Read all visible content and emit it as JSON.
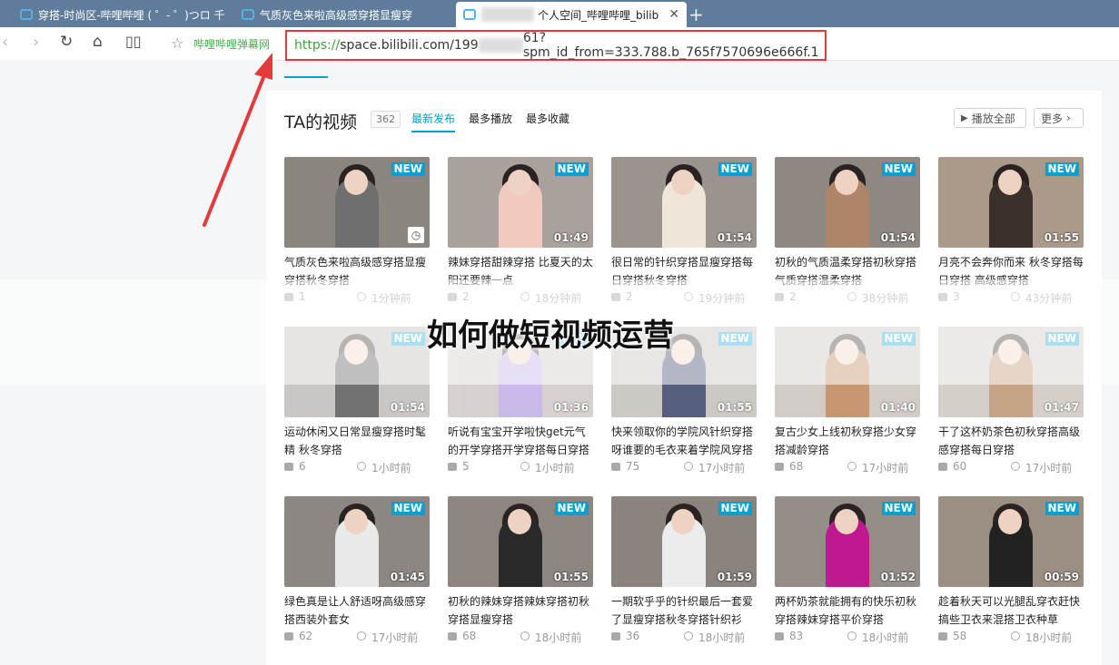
{
  "tabs": [
    {
      "label": "穿搭-时尚区-哔哩哔哩 ( ゜- ゜)つロ 千",
      "active": false
    },
    {
      "label": "气质灰色来啦高级感穿搭显瘦穿",
      "active": false
    },
    {
      "label": "个人空间_哔哩哔哩_bilib",
      "active": true
    }
  ],
  "bookmark": "哔哩哔哩弹幕网",
  "address": {
    "scheme": "https://",
    "host": "space.bilibili.com/",
    "prefix": "199",
    "suffix": "61?spm_id_from=333.788.b_765f7570696e666f.1"
  },
  "section": {
    "title": "TA的视频",
    "count": "362",
    "sorts": [
      "最新发布",
      "最多播放",
      "最多收藏"
    ],
    "play_all": "播放全部",
    "more": "更多"
  },
  "overlay_text": "如何做短视频运营",
  "videos": [
    {
      "title": "气质灰色来啦高级感穿搭显瘦穿搭秋冬穿搭",
      "new": "NEW",
      "duration": "",
      "plays": "1",
      "time": "1分钟前",
      "bg": "#8b8580",
      "cloth": "#6f6f6f"
    },
    {
      "title": "辣妹穿搭甜辣穿搭 比夏天的太阳还要辣一点",
      "new": "NEW",
      "duration": "01:49",
      "plays": "2",
      "time": "18分钟前",
      "bg": "#a9a29c",
      "cloth": "#f1c9bf"
    },
    {
      "title": "很日常的针织穿搭显瘦穿搭每日穿搭秋冬穿搭",
      "new": "NEW",
      "duration": "01:54",
      "plays": "2",
      "time": "19分钟前",
      "bg": "#9a938e",
      "cloth": "#efe6da"
    },
    {
      "title": "初秋的气质温柔穿搭初秋穿搭气质穿搭温柔穿搭",
      "new": "NEW",
      "duration": "01:54",
      "plays": "2",
      "time": "38分钟前",
      "bg": "#8f8882",
      "cloth": "#b08468"
    },
    {
      "title": "月亮不会奔你而来 秋冬穿搭每日穿搭 高级感穿搭",
      "new": "NEW",
      "duration": "01:55",
      "plays": "3",
      "time": "43分钟前",
      "bg": "#ab9a8a",
      "cloth": "#3a2f2b"
    },
    {
      "title": "运动休闲又日常显瘦穿搭时髦精 秋冬穿搭",
      "new": "NEW",
      "duration": "01:54",
      "plays": "6",
      "time": "1小时前",
      "bg": "#b9b4b0",
      "cloth": "#444444"
    },
    {
      "title": "听说有宝宝开学啦快get元气的开学穿搭开学穿搭每日穿搭",
      "new": "NEW",
      "duration": "01:36",
      "plays": "5",
      "time": "1小时前",
      "bg": "#c9c2c0",
      "cloth": "#b7a2e0"
    },
    {
      "title": "快来领取你的学院风针织穿搭呀谁要的毛衣来着学院风穿搭",
      "new": "NEW",
      "duration": "01:55",
      "plays": "75",
      "time": "17小时前",
      "bg": "#bcb6b1",
      "cloth": "#1f2a55"
    },
    {
      "title": "复古少女上线初秋穿搭少女穿搭减龄穿搭",
      "new": "NEW",
      "duration": "01:40",
      "plays": "68",
      "time": "17小时前",
      "bg": "#c2bbb4",
      "cloth": "#b8753f"
    },
    {
      "title": "干了这杯奶茶色初秋穿搭高级感穿搭每日穿搭",
      "new": "NEW",
      "duration": "01:47",
      "plays": "60",
      "time": "17小时前",
      "bg": "#c7c0b9",
      "cloth": "#b3865f"
    },
    {
      "title": "绿色真是让人舒适呀高级感穿搭西装外套女",
      "new": "NEW",
      "duration": "01:45",
      "plays": "62",
      "time": "17小时前",
      "bg": "#8c8782",
      "cloth": "#e9e9e9"
    },
    {
      "title": "初秋的辣妹穿搭辣妹穿搭初秋穿搭显瘦穿搭",
      "new": "NEW",
      "duration": "01:55",
      "plays": "68",
      "time": "18小时前",
      "bg": "#8d8580",
      "cloth": "#2a2a2a"
    },
    {
      "title": "一期软乎乎的针织最后一套爱了显瘦穿搭秋冬穿搭针织衫",
      "new": "NEW",
      "duration": "01:59",
      "plays": "36",
      "time": "18小时前",
      "bg": "#8a837e",
      "cloth": "#ececec"
    },
    {
      "title": "两杯奶茶就能拥有的快乐初秋穿搭辣妹穿搭平价穿搭",
      "new": "NEW",
      "duration": "01:52",
      "plays": "83",
      "time": "18小时前",
      "bg": "#948d88",
      "cloth": "#c0188f"
    },
    {
      "title": "趁着秋天可以光腿乱穿衣赶快搞些卫衣来混搭卫衣种草",
      "new": "NEW",
      "duration": "00:59",
      "plays": "58",
      "time": "18小时前",
      "bg": "#9b8f84",
      "cloth": "#222222"
    }
  ]
}
